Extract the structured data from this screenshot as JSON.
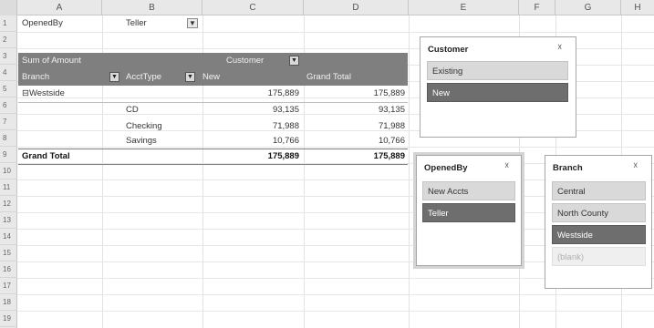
{
  "columns": [
    "A",
    "B",
    "C",
    "D",
    "E",
    "F",
    "G",
    "H"
  ],
  "rows": [
    "1",
    "2",
    "3",
    "4",
    "5",
    "6",
    "7",
    "8",
    "9",
    "10",
    "11",
    "12",
    "13",
    "14",
    "15",
    "16",
    "17",
    "18",
    "19"
  ],
  "report_filter": {
    "label": "OpenedBy",
    "value": "Teller",
    "filter_icon": "funnel-icon"
  },
  "pivot": {
    "values_label": "Sum of Amount",
    "col_field": "Customer",
    "row_field": "Branch",
    "sub_field": "AcctType",
    "col_item": "New",
    "grand_total_label": "Grand Total",
    "rows": [
      {
        "branch": "⊟Westside",
        "acct": "",
        "new": "175,889",
        "total": "175,889"
      },
      {
        "branch": "",
        "acct": "CD",
        "new": "93,135",
        "total": "93,135"
      },
      {
        "branch": "",
        "acct": "Checking",
        "new": "71,988",
        "total": "71,988"
      },
      {
        "branch": "",
        "acct": "Savings",
        "new": "10,766",
        "total": "10,766"
      }
    ],
    "grand_total": {
      "label": "Grand Total",
      "new": "175,889",
      "total": "175,889"
    }
  },
  "slicers": {
    "customer": {
      "title": "Customer",
      "clear_icon": "clear-filter-icon",
      "items": [
        {
          "label": "Existing",
          "state": "off"
        },
        {
          "label": "New",
          "state": "on"
        }
      ]
    },
    "openedby": {
      "title": "OpenedBy",
      "clear_icon": "clear-filter-icon",
      "items": [
        {
          "label": "New Accts",
          "state": "off"
        },
        {
          "label": "Teller",
          "state": "on"
        }
      ]
    },
    "branch": {
      "title": "Branch",
      "clear_icon": "clear-filter-icon",
      "items": [
        {
          "label": "Central",
          "state": "off"
        },
        {
          "label": "North County",
          "state": "off"
        },
        {
          "label": "Westside",
          "state": "on"
        },
        {
          "label": "(blank)",
          "state": "nodata"
        }
      ]
    }
  }
}
